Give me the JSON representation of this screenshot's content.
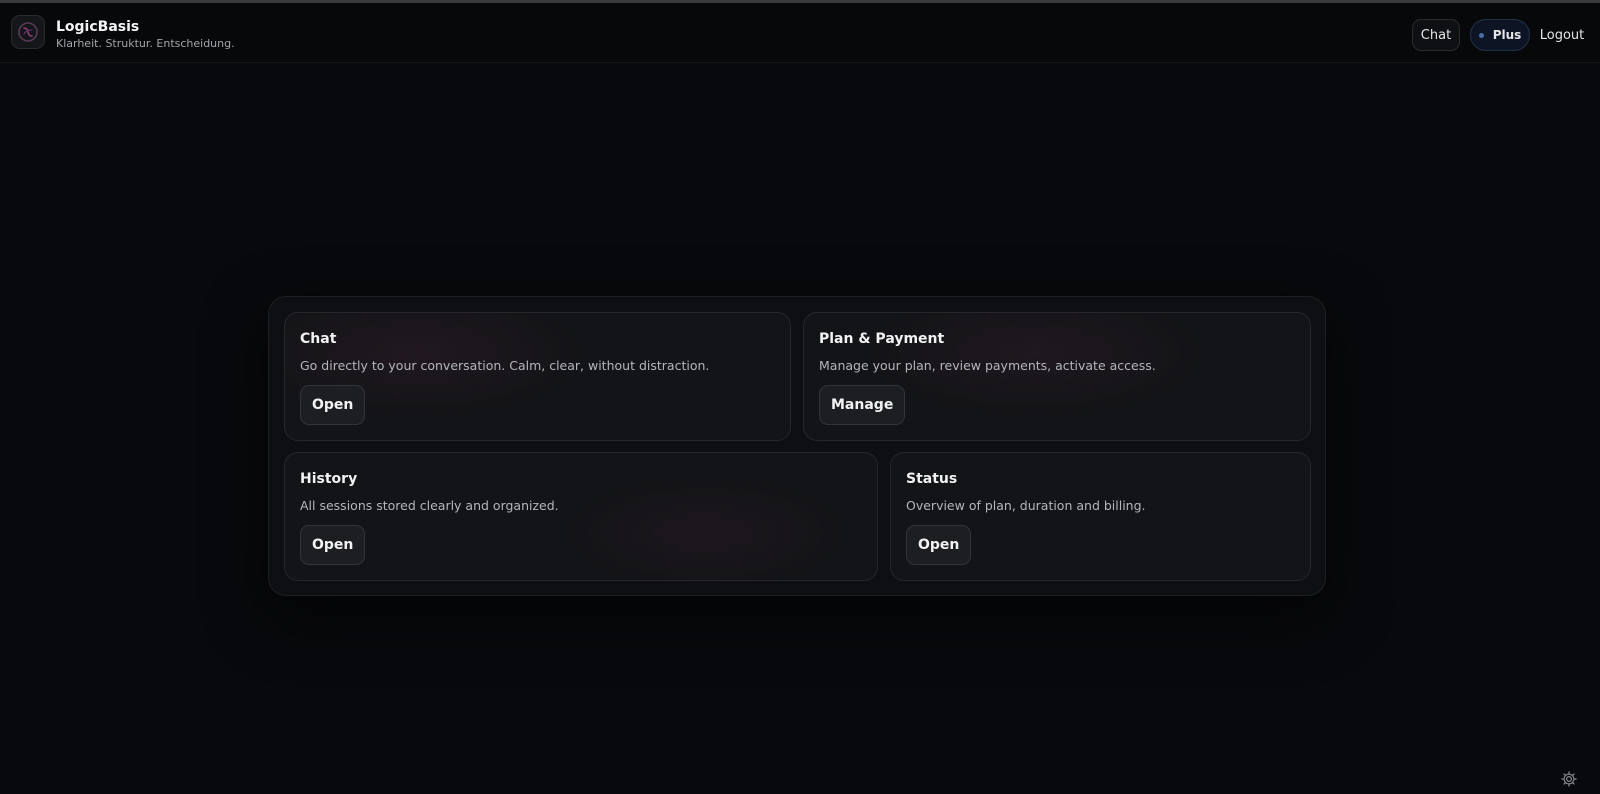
{
  "header": {
    "brand_name": "LogicBasis",
    "brand_tagline": "Klarheit. Struktur. Entscheidung.",
    "nav": {
      "chat_label": "Chat",
      "plan_badge_label": "Plus",
      "logout_label": "Logout"
    }
  },
  "cards": {
    "chat": {
      "title": "Chat",
      "description": "Go directly to your conversation. Calm, clear, without distraction.",
      "button_label": "Open"
    },
    "plan": {
      "title": "Plan & Payment",
      "description": "Manage your plan, review payments, activate access.",
      "button_label": "Manage"
    },
    "history": {
      "title": "History",
      "description": "All sessions stored clearly and organized.",
      "button_label": "Open"
    },
    "status": {
      "title": "Status",
      "description": "Overview of plan, duration and billing.",
      "button_label": "Open"
    }
  },
  "icons": {
    "logo": "logo-icon",
    "status_dot": "status-dot-icon",
    "settings": "gear-icon"
  },
  "colors": {
    "background": "#08090c",
    "card": "#131417",
    "plan_badge_bg": "#0d1524",
    "plan_badge_dot": "#4a6da8"
  }
}
